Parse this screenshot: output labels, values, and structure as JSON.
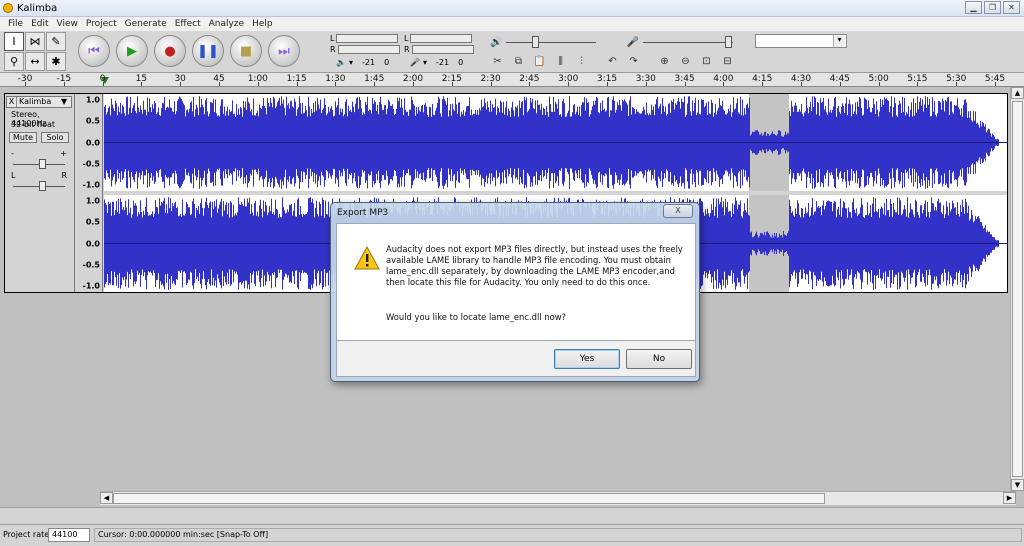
{
  "window": {
    "title": "Kalimba"
  },
  "menu": [
    "File",
    "Edit",
    "View",
    "Project",
    "Generate",
    "Effect",
    "Analyze",
    "Help"
  ],
  "meters": {
    "left_label": "L",
    "right_label": "R",
    "playback_level": "-21",
    "playback_zero": "0",
    "record_level": "-21",
    "record_zero": "0"
  },
  "ruler": [
    "-30",
    "-15",
    "0",
    "15",
    "30",
    "45",
    "1:00",
    "1:15",
    "1:30",
    "1:45",
    "2:00",
    "2:15",
    "2:30",
    "2:45",
    "3:00",
    "3:15",
    "3:30",
    "3:45",
    "4:00",
    "4:15",
    "4:30",
    "4:45",
    "5:00",
    "5:15",
    "5:30",
    "5:45"
  ],
  "track": {
    "close": "X",
    "name": "Kalimba",
    "format": "Stereo, 44100Hz",
    "bit_depth": "32-bit float",
    "mute_label": "Mute",
    "solo_label": "Solo",
    "gain_minus": "-",
    "gain_plus": "+",
    "pan_left": "L",
    "pan_right": "R",
    "scale": [
      "1.0",
      "0.5",
      "0.0",
      "-0.5",
      "-1.0"
    ]
  },
  "status": {
    "project_rate_label": "Project rate:",
    "project_rate": "44100",
    "cursor_text": "Cursor: 0:00.000000 min:sec   [Snap-To Off]"
  },
  "dialog": {
    "title": "Export MP3",
    "close": "X",
    "message": "Audacity does not export MP3 files directly, but instead uses the freely available LAME library to handle MP3 file encoding.  You must obtain lame_enc.dll separately, by downloading the LAME MP3 encoder,and then locate this file for Audacity.  You only need to do this once.",
    "question": "Would you like to locate lame_enc.dll now?",
    "yes_label": "Yes",
    "no_label": "No"
  },
  "colors": {
    "waveform": "#3232c8",
    "waveform_background": "#ffffff",
    "selection_gap": "#c4c4c4"
  }
}
